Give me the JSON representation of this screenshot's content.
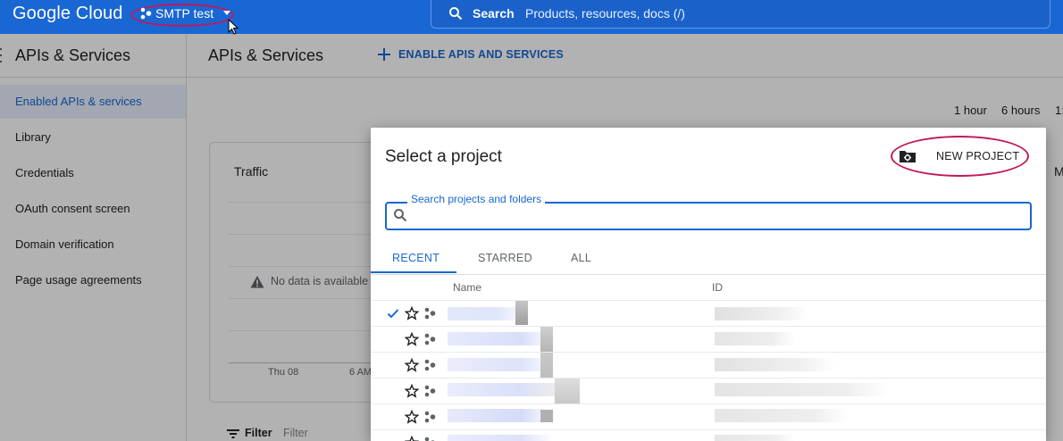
{
  "header": {
    "logo": "Google Cloud",
    "project": "SMTP test",
    "search_label": "Search",
    "search_placeholder": "Products, resources, docs (/)"
  },
  "sidebar": {
    "title": "APIs & Services",
    "items": [
      {
        "label": "Enabled APIs & services",
        "active": true
      },
      {
        "label": "Library"
      },
      {
        "label": "Credentials"
      },
      {
        "label": "OAuth consent screen"
      },
      {
        "label": "Domain verification"
      },
      {
        "label": "Page usage agreements"
      }
    ]
  },
  "main": {
    "title": "APIs & Services",
    "enable_button": "ENABLE APIS AND SERVICES",
    "time_ranges": [
      "1 hour",
      "6 hours",
      "1:"
    ],
    "traffic_title": "Traffic",
    "no_data": "No data is available",
    "axis_labels": [
      "Thu 08",
      "6 AM"
    ],
    "filter_label": "Filter",
    "filter_placeholder": "Filter",
    "right_edge_letter": "M"
  },
  "dialog": {
    "title": "Select a project",
    "new_project": "NEW PROJECT",
    "search_label": "Search projects and folders",
    "tabs": [
      "RECENT",
      "STARRED",
      "ALL"
    ],
    "columns": {
      "name": "Name",
      "id": "ID"
    }
  },
  "colors": {
    "brand": "#1967d2",
    "annotation": "#c2185b"
  }
}
